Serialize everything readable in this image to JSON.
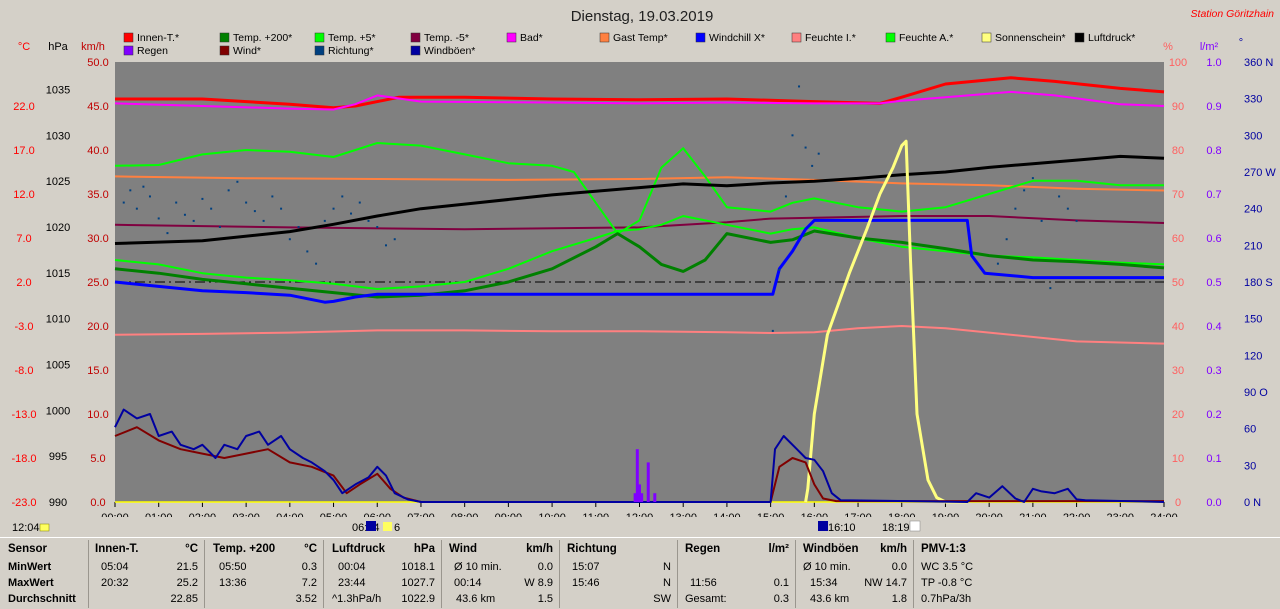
{
  "chart_data": {
    "type": "line",
    "title": "Dienstag, 19.03.2019",
    "station": "Station Göritzhain",
    "x_ticks": [
      "00:00",
      "01:00",
      "02:00",
      "03:00",
      "04:00",
      "05:00",
      "06:00",
      "07:00",
      "08:00",
      "09:00",
      "10:00",
      "11:00",
      "12:00",
      "13:00",
      "14:00",
      "15:00",
      "16:00",
      "17:00",
      "18:00",
      "19:00",
      "20:00",
      "21:00",
      "22:00",
      "23:00",
      "24:00"
    ],
    "xlim": [
      0,
      24
    ],
    "axes": {
      "temp_c": {
        "label": "°C",
        "color": "#ff0000",
        "ticks": [
          "22.0",
          "17.0",
          "12.0",
          "7.0",
          "2.0",
          "-3.0",
          "-8.0",
          "-13.0",
          "-18.0",
          "-23.0"
        ],
        "range": [
          -23,
          27
        ]
      },
      "pressure_hpa": {
        "label": "hPa",
        "color": "#000000",
        "ticks": [
          "1035",
          "1030",
          "1025",
          "1020",
          "1015",
          "1010",
          "1005",
          "1000",
          "995",
          "990"
        ],
        "range": [
          990,
          1038
        ]
      },
      "wind_kmh": {
        "label": "km/h",
        "color": "#c00000",
        "ticks": [
          "50.0",
          "45.0",
          "40.0",
          "35.0",
          "30.0",
          "25.0",
          "20.0",
          "15.0",
          "10.0",
          "5.0",
          "0.0"
        ],
        "range": [
          0,
          50
        ]
      },
      "humidity_pct": {
        "label": "%",
        "color": "#ff6060",
        "ticks": [
          "100",
          "90",
          "80",
          "70",
          "60",
          "50",
          "40",
          "30",
          "20",
          "10",
          "0"
        ],
        "range": [
          0,
          100
        ]
      },
      "rain_lm2": {
        "label": "l/m²",
        "color": "#8000ff",
        "ticks": [
          "1.0",
          "0.9",
          "0.8",
          "0.7",
          "0.6",
          "0.5",
          "0.4",
          "0.3",
          "0.2",
          "0.1",
          "0.0"
        ],
        "range": [
          0,
          1
        ]
      },
      "direction": {
        "label": "°",
        "color": "#0000a0",
        "ticks": [
          "360 N",
          "330",
          "300",
          "270 W",
          "240",
          "210",
          "180 S",
          "150",
          "120",
          "90 O",
          "60",
          "30",
          "0 N"
        ],
        "range": [
          0,
          360
        ]
      }
    },
    "legend": [
      {
        "name": "Innen-T.*",
        "color": "#ff0000"
      },
      {
        "name": "Temp. +200*",
        "color": "#008000"
      },
      {
        "name": "Temp. +5*",
        "color": "#00ff00"
      },
      {
        "name": "Temp. -5*",
        "color": "#800040"
      },
      {
        "name": "Bad*",
        "color": "#ff00ff"
      },
      {
        "name": "Gast Temp*",
        "color": "#ff8040"
      },
      {
        "name": "Windchill X*",
        "color": "#0000ff"
      },
      {
        "name": "Feuchte I.*",
        "color": "#ff8080"
      },
      {
        "name": "Feuchte A.*",
        "color": "#00ff00"
      },
      {
        "name": "Sonnenschein*",
        "color": "#ffff80"
      },
      {
        "name": "Luftdruck*",
        "color": "#000000"
      },
      {
        "name": "Regen",
        "color": "#8000ff"
      },
      {
        "name": "Wind*",
        "color": "#800000"
      },
      {
        "name": "Richtung*",
        "color": "#004080"
      },
      {
        "name": "Windböen*",
        "color": "#0000a0"
      }
    ],
    "series": [
      {
        "name": "Innen-T.*",
        "axis": "temp_c",
        "color": "#ff0000",
        "width": 3,
        "x": [
          0,
          2,
          4,
          5,
          5.5,
          6.5,
          8,
          10,
          12,
          14,
          16,
          17.5,
          18,
          19,
          20.5,
          21.5,
          23,
          24
        ],
        "y": [
          22.8,
          22.8,
          22.2,
          21.8,
          22.0,
          23.0,
          23.0,
          22.8,
          22.7,
          22.8,
          22.5,
          22.3,
          23.0,
          24.5,
          25.2,
          24.8,
          24.0,
          23.6
        ]
      },
      {
        "name": "Bad*",
        "axis": "temp_c",
        "color": "#ff00ff",
        "width": 2,
        "x": [
          0,
          2,
          4,
          5,
          5.5,
          6,
          7,
          10,
          12,
          14,
          16,
          17.5,
          18,
          19,
          20.5,
          21.5,
          23,
          24
        ],
        "y": [
          22.3,
          22.0,
          21.7,
          21.6,
          22.2,
          23.2,
          22.5,
          22.4,
          22.3,
          22.4,
          22.3,
          22.3,
          22.6,
          23.0,
          23.6,
          23.2,
          22.2,
          22.0
        ]
      },
      {
        "name": "Gast Temp*",
        "axis": "temp_c",
        "color": "#ff8040",
        "width": 2,
        "x": [
          0,
          3,
          6,
          9,
          12,
          14,
          16,
          18,
          20,
          22,
          24
        ],
        "y": [
          14.0,
          13.8,
          13.7,
          13.6,
          13.7,
          13.9,
          13.6,
          13.2,
          13.0,
          12.6,
          12.4
        ]
      },
      {
        "name": "Temp. -5*",
        "axis": "temp_c",
        "color": "#800040",
        "width": 2,
        "x": [
          0,
          4,
          8,
          12,
          14,
          15,
          16,
          18,
          20,
          22,
          24
        ],
        "y": [
          8.5,
          8.2,
          8.0,
          8.2,
          8.8,
          9.2,
          9.3,
          9.5,
          9.5,
          9.0,
          8.7
        ]
      },
      {
        "name": "Temp. +5*",
        "axis": "temp_c",
        "color": "#00ff00",
        "width": 2,
        "x": [
          0,
          1,
          2,
          3,
          4,
          5,
          6,
          7,
          8,
          9,
          10,
          10.5,
          11,
          11.5,
          12,
          12.5,
          13,
          13.5,
          14,
          15,
          15.5,
          16,
          17,
          18,
          19,
          20,
          21,
          22,
          23,
          24
        ],
        "y": [
          15.2,
          15.3,
          16.5,
          17.0,
          16.8,
          16.2,
          17.8,
          17.5,
          16.5,
          15.5,
          15.2,
          14.5,
          11.0,
          7.5,
          9.0,
          15.0,
          17.2,
          14.0,
          10.5,
          10.0,
          11.0,
          11.5,
          10.5,
          10.0,
          10.5,
          12.0,
          13.5,
          13.5,
          13.0,
          13.0
        ]
      },
      {
        "name": "Feuchte A.*",
        "axis": "temp_c",
        "color": "#00ff00",
        "width": 2,
        "x": [
          0,
          1,
          2,
          3,
          4,
          5,
          6,
          7,
          8,
          9,
          10,
          11,
          11.5,
          12,
          12.5,
          13,
          13.5,
          14,
          15,
          15.5,
          16,
          17,
          18,
          19,
          20,
          21,
          22,
          23,
          24
        ],
        "y": [
          4.5,
          4.0,
          3.0,
          2.5,
          2.2,
          1.8,
          1.2,
          1.5,
          2.0,
          3.5,
          5.5,
          7.0,
          7.8,
          8.0,
          8.5,
          9.5,
          9.0,
          8.5,
          7.5,
          8.0,
          8.2,
          7.0,
          6.0,
          5.5,
          5.0,
          4.8,
          4.5,
          4.2,
          4.0
        ]
      },
      {
        "name": "Temp. +200*",
        "axis": "temp_c",
        "color": "#008000",
        "width": 3,
        "x": [
          0,
          1,
          2,
          3,
          4,
          5,
          6,
          7,
          8,
          9,
          10,
          11,
          11.5,
          12,
          12.5,
          13,
          13.5,
          14,
          15,
          15.5,
          16,
          17,
          18,
          19,
          20,
          21,
          22,
          23,
          24
        ],
        "y": [
          3.5,
          3.0,
          2.3,
          1.8,
          1.3,
          0.8,
          0.3,
          0.5,
          1.0,
          2.0,
          3.5,
          6.0,
          7.5,
          6.0,
          4.0,
          3.2,
          4.5,
          7.5,
          6.5,
          6.8,
          7.8,
          7.0,
          6.5,
          5.8,
          5.0,
          4.5,
          4.3,
          4.0,
          3.6
        ]
      },
      {
        "name": "Luftdruck*",
        "axis": "pressure_hpa",
        "color": "#000000",
        "width": 3,
        "x": [
          0,
          2,
          4,
          5,
          6,
          7,
          8,
          10,
          12,
          13,
          14,
          15,
          16,
          17,
          18,
          19,
          20,
          21,
          22,
          23,
          24
        ],
        "y": [
          1018.2,
          1018.5,
          1019.5,
          1020.3,
          1021.2,
          1022.0,
          1022.5,
          1023.5,
          1024.3,
          1024.7,
          1024.5,
          1024.8,
          1025.0,
          1025.3,
          1025.7,
          1026.0,
          1026.5,
          1026.9,
          1027.3,
          1027.7,
          1027.5
        ]
      },
      {
        "name": "Windchill X*",
        "axis": "temp_c",
        "color": "#0000ff",
        "width": 3,
        "step": true,
        "x": [
          0,
          1,
          2,
          3,
          4,
          4.8,
          5,
          5.5,
          6,
          8,
          10,
          12,
          14,
          15.05,
          15.2,
          15.5,
          15.8,
          16,
          17,
          18,
          19,
          19.5,
          19.6,
          19.9,
          21,
          22,
          23,
          24
        ],
        "y": [
          2.0,
          1.5,
          1.0,
          0.8,
          0.5,
          -0.3,
          -0.2,
          0.3,
          0.6,
          0.6,
          0.6,
          0.6,
          0.6,
          0.6,
          3.5,
          5.5,
          8.0,
          9.0,
          9.0,
          9.0,
          9.0,
          9.0,
          5.0,
          3.0,
          2.5,
          2.5,
          2.5,
          2.5
        ]
      },
      {
        "name": "Feuchte I.*",
        "axis": "humidity_pct",
        "color": "#ff8080",
        "width": 2,
        "x": [
          0,
          2,
          4,
          6,
          8,
          10,
          12,
          14,
          15,
          16,
          17,
          18,
          19,
          20,
          22,
          24
        ],
        "y": [
          38.0,
          38.2,
          38.5,
          39.0,
          39.0,
          38.8,
          38.8,
          38.6,
          38.4,
          38.6,
          39.5,
          40.0,
          39.5,
          38.5,
          36.5,
          36.0
        ]
      },
      {
        "name": "Sonnenschein*",
        "axis": "humidity_pct",
        "color": "#ffff80",
        "width": 3,
        "x": [
          15.8,
          15.85,
          16.0,
          16.3,
          16.8,
          17.2,
          17.5,
          17.8,
          18.0,
          18.1,
          18.2,
          18.35,
          18.6,
          18.8,
          19.0,
          19.5
        ],
        "y": [
          0,
          3.0,
          20.0,
          38.0,
          52.0,
          62.0,
          70.0,
          76.0,
          81.0,
          82.0,
          55.0,
          20.0,
          5.0,
          1.0,
          0,
          0
        ]
      },
      {
        "name": "Wind*",
        "axis": "wind_kmh",
        "color": "#800000",
        "width": 2,
        "x": [
          0,
          0.5,
          1,
          1.5,
          2,
          2.5,
          3,
          3.5,
          4,
          4.5,
          5,
          5.3,
          5.6,
          6,
          6.3,
          6.6,
          7,
          15,
          15.2,
          15.5,
          15.8,
          16,
          16.2,
          16.5,
          24
        ],
        "y": [
          7.5,
          8.5,
          7.0,
          6.0,
          5.5,
          5.0,
          5.5,
          6.0,
          4.5,
          4.0,
          3.0,
          1.0,
          2.0,
          3.2,
          1.5,
          0.5,
          0,
          0,
          4.0,
          5.0,
          4.5,
          2.0,
          0.4,
          0.1,
          0.1
        ]
      },
      {
        "name": "Windböen*",
        "axis": "wind_kmh",
        "color": "#0000a0",
        "width": 2,
        "x": [
          0,
          0.2,
          0.5,
          0.8,
          1,
          1.3,
          1.5,
          1.8,
          2,
          2.3,
          2.5,
          2.8,
          3,
          3.3,
          3.5,
          3.8,
          4,
          4.3,
          4.5,
          4.8,
          5,
          5.2,
          5.5,
          5.8,
          6,
          6.2,
          6.4,
          6.7,
          7,
          15,
          15.1,
          15.3,
          15.6,
          15.8,
          16,
          16.2,
          16.4,
          16.6,
          19.5,
          19.7,
          20,
          20.3,
          20.6,
          20.8,
          21,
          21.2,
          21.5,
          21.8,
          22,
          22.2,
          24
        ],
        "y": [
          8.5,
          10.5,
          9.5,
          10.0,
          7.5,
          8.0,
          6.5,
          6.0,
          6.5,
          5.0,
          6.5,
          6.0,
          7.5,
          8.0,
          6.5,
          7.5,
          6.0,
          5.0,
          4.5,
          3.5,
          2.5,
          1.0,
          2.0,
          2.8,
          4.0,
          3.0,
          1.0,
          0.3,
          0,
          0,
          6.0,
          7.5,
          6.0,
          5.0,
          4.8,
          3.5,
          1.0,
          0.2,
          0,
          1.0,
          0.5,
          1.8,
          0.4,
          0,
          1.5,
          1.2,
          1.0,
          1.5,
          0.3,
          0.2,
          0
        ]
      },
      {
        "name": "Regen",
        "axis": "rain_lm2",
        "type": "bar",
        "color": "#8000ff",
        "x": [
          11.9,
          11.95,
          12.0,
          12.05,
          12.2,
          12.35
        ],
        "y": [
          0.02,
          0.12,
          0.04,
          0.02,
          0.09,
          0.02
        ]
      },
      {
        "name": "Richtung*",
        "axis": "direction",
        "type": "scatter",
        "color": "#004080",
        "x": [
          0.2,
          0.35,
          0.5,
          0.65,
          0.8,
          1.0,
          1.2,
          1.4,
          1.6,
          1.8,
          2.0,
          2.2,
          2.4,
          2.6,
          2.8,
          3.0,
          3.2,
          3.4,
          3.6,
          3.8,
          4.0,
          4.2,
          4.4,
          4.6,
          4.8,
          5.0,
          5.2,
          5.4,
          5.6,
          5.8,
          6.0,
          6.2,
          6.4,
          15.05,
          15.2,
          15.35,
          15.5,
          15.65,
          15.8,
          15.95,
          16.1,
          20.2,
          20.4,
          20.6,
          20.8,
          21.0,
          21.2,
          21.4,
          21.6,
          21.8,
          22.0
        ],
        "y": [
          245,
          255,
          240,
          258,
          250,
          232,
          220,
          245,
          235,
          230,
          248,
          240,
          225,
          255,
          262,
          245,
          238,
          230,
          250,
          240,
          215,
          225,
          205,
          195,
          230,
          240,
          250,
          236,
          245,
          230,
          225,
          210,
          215,
          140,
          190,
          250,
          300,
          340,
          290,
          275,
          285,
          195,
          215,
          240,
          255,
          265,
          230,
          175,
          250,
          240,
          230
        ]
      }
    ],
    "hline": {
      "axis": "temp_c",
      "value": 2.0,
      "style": "dashed"
    },
    "markers": [
      {
        "label": "12:04",
        "x": 0
      },
      {
        "label": "06:14",
        "x": 6.2
      },
      {
        "label": "16:10",
        "x": 16.17
      },
      {
        "label": "18:19",
        "x": 18.3
      }
    ],
    "marker_text": {
      "m0": "12:04",
      "m1": "06:14",
      "m1b": "6",
      "m2": "16:10",
      "m3": "18:19"
    }
  },
  "stats_panel": {
    "row_labels": {
      "title": "Sensor",
      "min": "MinWert",
      "max": "MaxWert",
      "avg": "Durchschnitt"
    },
    "innen": {
      "title": "Innen-T.",
      "unit": "°C",
      "min_time": "05:04",
      "min_val": "21.5",
      "max_time": "20:32",
      "max_val": "25.2",
      "avg": "22.85"
    },
    "temp200": {
      "title": "Temp. +200",
      "unit": "°C",
      "min_time": "05:50",
      "min_val": "0.3",
      "max_time": "13:36",
      "max_val": "7.2",
      "avg": "3.52"
    },
    "druck": {
      "title": "Luftdruck",
      "unit": "hPa",
      "min_time": "00:04",
      "min_val": "1018.1",
      "max_time": "23:44",
      "max_val": "1027.7",
      "trend": "^1.3hPa/h",
      "avg": "1022.9"
    },
    "wind": {
      "title": "Wind",
      "unit": "km/h",
      "r1_label": "Ø 10 min.",
      "r1_val": "0.0",
      "r2_time": "00:14",
      "r2_val": "W 8.9",
      "r3_label": "43.6 km",
      "r3_val": "1.5"
    },
    "richtung": {
      "title": "Richtung",
      "r1_time": "15:07",
      "r1_val": "N",
      "r2_time": "15:46",
      "r2_val": "N",
      "r3_val": "SW"
    },
    "regen": {
      "title": "Regen",
      "unit": "l/m²",
      "r2_time": "11:56",
      "r2_val": "0.1",
      "r3_label": "Gesamt:",
      "r3_val": "0.3"
    },
    "boeen": {
      "title": "Windböen",
      "unit": "km/h",
      "r1_label": "Ø 10 min.",
      "r1_val": "0.0",
      "r2_time": "15:34",
      "r2_val": "NW 14.7",
      "r3_label": "43.6 km",
      "r3_val": "1.8"
    },
    "pmv": {
      "title": "PMV-1:3",
      "r1": "WC 3.5 °C",
      "r2": "TP -0.8 °C",
      "r3": "0.7hPa/3h"
    }
  },
  "colors": {
    "plot_bg": "#808080",
    "frame_bg": "#d4d0c8"
  }
}
